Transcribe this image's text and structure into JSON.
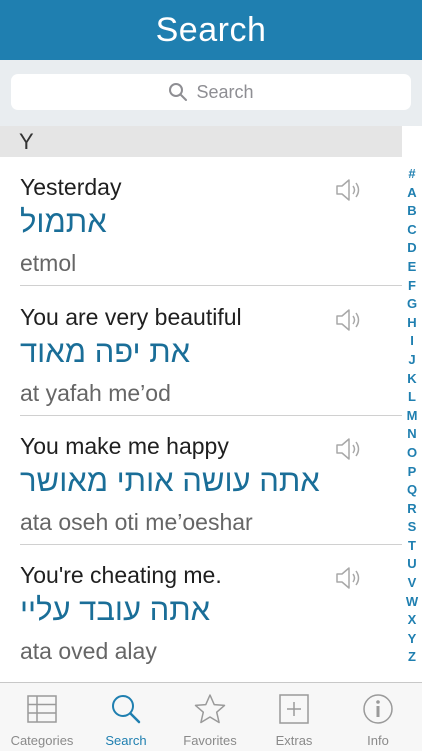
{
  "header": {
    "title": "Search"
  },
  "search": {
    "placeholder": "Search"
  },
  "section": {
    "letter": "Y"
  },
  "entries": [
    {
      "english": "Yesterday",
      "hebrew": "אתמול",
      "translit": "etmol"
    },
    {
      "english": "You are very beautiful",
      "hebrew": "את יפה מאוד",
      "translit": "at yafah me’od"
    },
    {
      "english": "You make me happy",
      "hebrew": "אתה עושה אותי מאושר",
      "translit": "ata oseh oti me’oeshar"
    },
    {
      "english": "You're cheating me.",
      "hebrew": "אתה עובד עליי",
      "translit": "ata oved alay"
    }
  ],
  "index": [
    "#",
    "A",
    "B",
    "C",
    "D",
    "E",
    "F",
    "G",
    "H",
    "I",
    "J",
    "K",
    "L",
    "M",
    "N",
    "O",
    "P",
    "Q",
    "R",
    "S",
    "T",
    "U",
    "V",
    "W",
    "X",
    "Y",
    "Z"
  ],
  "tabs": [
    {
      "label": "Categories",
      "icon": "categories-icon",
      "active": false
    },
    {
      "label": "Search",
      "icon": "search-icon",
      "active": true
    },
    {
      "label": "Favorites",
      "icon": "star-icon",
      "active": false
    },
    {
      "label": "Extras",
      "icon": "plus-icon",
      "active": false
    },
    {
      "label": "Info",
      "icon": "info-icon",
      "active": false
    }
  ],
  "colors": {
    "accent": "#1f7fb0",
    "hebrew_text": "#1a6e98",
    "inactive": "#8a8a8a"
  }
}
